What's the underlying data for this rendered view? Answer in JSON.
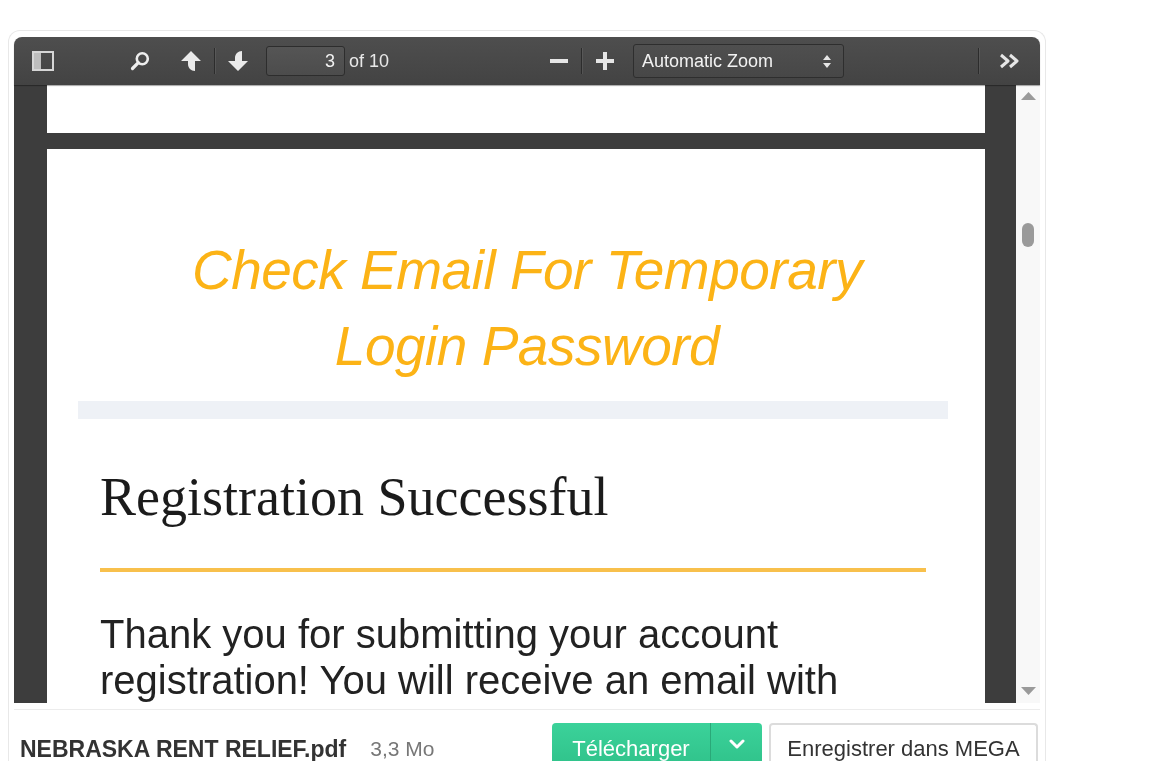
{
  "viewer": {
    "toolbar": {
      "page_number": "3",
      "page_total": "of 10",
      "zoom": "Automatic Zoom"
    },
    "pages": [
      {
        "kind": "fragment"
      },
      {
        "kind": "content",
        "banner": "Check Email For Temporary Login Password",
        "heading": "Registration Successful",
        "body": "Thank you for submitting your account registration! You will receive an email with"
      }
    ]
  },
  "footer": {
    "file_name": "NEBRASKA RENT RELIEF.pdf",
    "file_size": "3,3 Mo",
    "buttons": [
      {
        "label": "Télécharger",
        "kind": "split"
      },
      {
        "label": "Enregistrer dans MEGA",
        "kind": "outline"
      }
    ]
  }
}
